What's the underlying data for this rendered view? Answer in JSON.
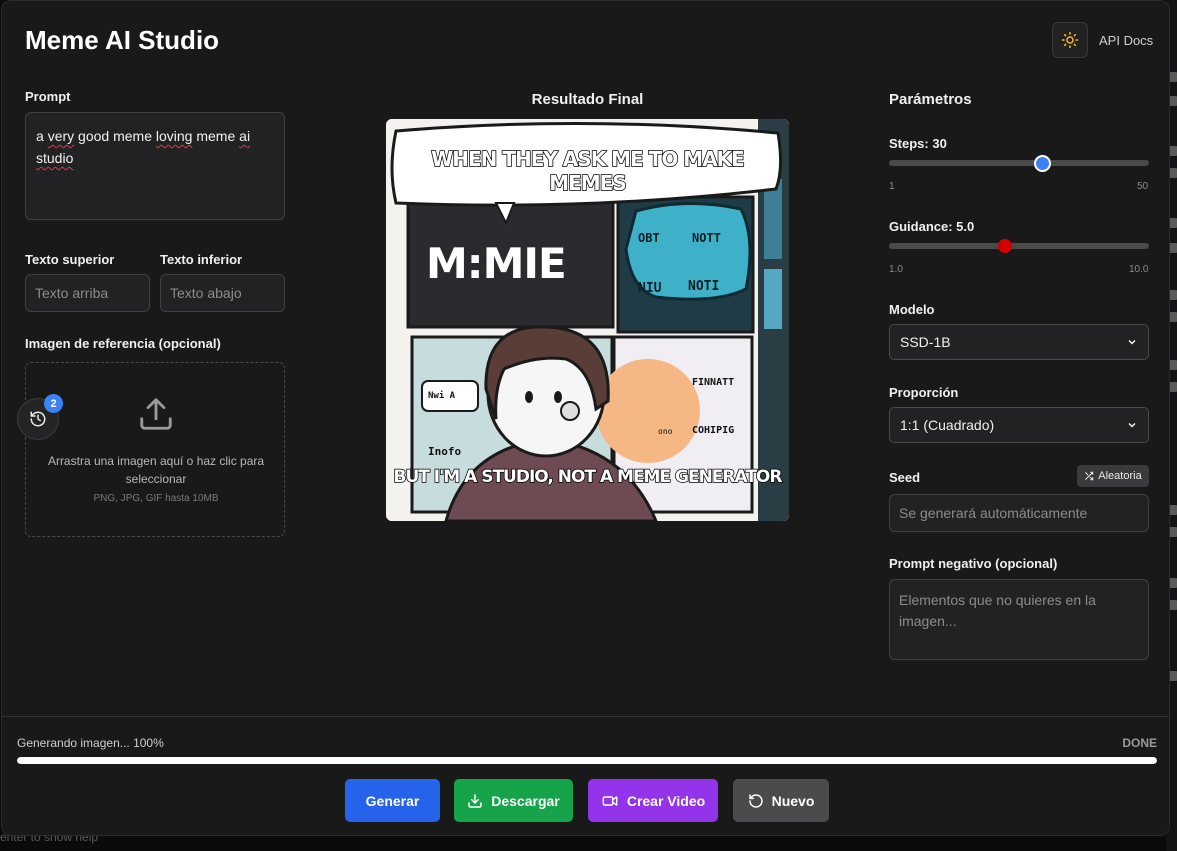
{
  "app": {
    "title": "Meme AI Studio",
    "api_docs": "API Docs"
  },
  "left": {
    "prompt_label": "Prompt",
    "prompt_value_plain": "a very good meme loving meme ai",
    "prompt_words": [
      "a",
      "very",
      "good",
      "meme",
      "loving",
      "meme",
      "ai",
      "studio"
    ],
    "top_text_label": "Texto superior",
    "top_text_placeholder": "Texto arriba",
    "bottom_text_label": "Texto inferior",
    "bottom_text_placeholder": "Texto abajo",
    "reference_label": "Imagen de referencia (opcional)",
    "drop_text": "Arrastra una imagen aquí o haz clic para seleccionar",
    "drop_hint": "PNG, JPG, GIF hasta 10MB",
    "history_count": "2"
  },
  "result": {
    "title": "Resultado Final",
    "top_caption": "WHEN THEY ASK ME TO MAKE MEMES",
    "bottom_caption": "BUT I'M A STUDIO, NOT A MEME GENERATOR",
    "panel_word": "M:MIE",
    "bubble_words": [
      "OBT",
      "NOTT",
      "NIU",
      "NOTI"
    ],
    "panel_notes": [
      "FINNATT",
      "COHIPIG",
      "Inofo",
      "Nwi A",
      "ono"
    ]
  },
  "params": {
    "title": "Parámetros",
    "steps_label": "Steps: 30",
    "steps": {
      "min_label": "1",
      "max_label": "50",
      "value": 30,
      "min": 1,
      "max": 50
    },
    "guidance_label": "Guidance: 5.0",
    "guidance": {
      "min_label": "1.0",
      "max_label": "10.0",
      "value": 5.0,
      "min": 1,
      "max": 10
    },
    "model_label": "Modelo",
    "model_value": "SSD-1B",
    "ratio_label": "Proporción",
    "ratio_value": "1:1 (Cuadrado)",
    "seed_label": "Seed",
    "seed_random": "Aleatoria",
    "seed_placeholder": "Se generará automáticamente",
    "negative_label": "Prompt negativo (opcional)",
    "negative_placeholder": "Elementos que no quieres en la imagen..."
  },
  "footer": {
    "status": "Generando imagen... 100%",
    "done": "DONE",
    "progress": 1.0,
    "buttons": {
      "generate": "Generar",
      "download": "Descargar",
      "video": "Crear Video",
      "new": "Nuevo"
    }
  },
  "colors": {
    "accent_blue": "#3b82f6",
    "generate": "#2563eb",
    "download": "#16a34a",
    "video": "#9333ea",
    "new": "#4b4b4d",
    "guidance_thumb": "#d40000"
  },
  "background": {
    "bottom_hint": "enter  to  show  help"
  }
}
